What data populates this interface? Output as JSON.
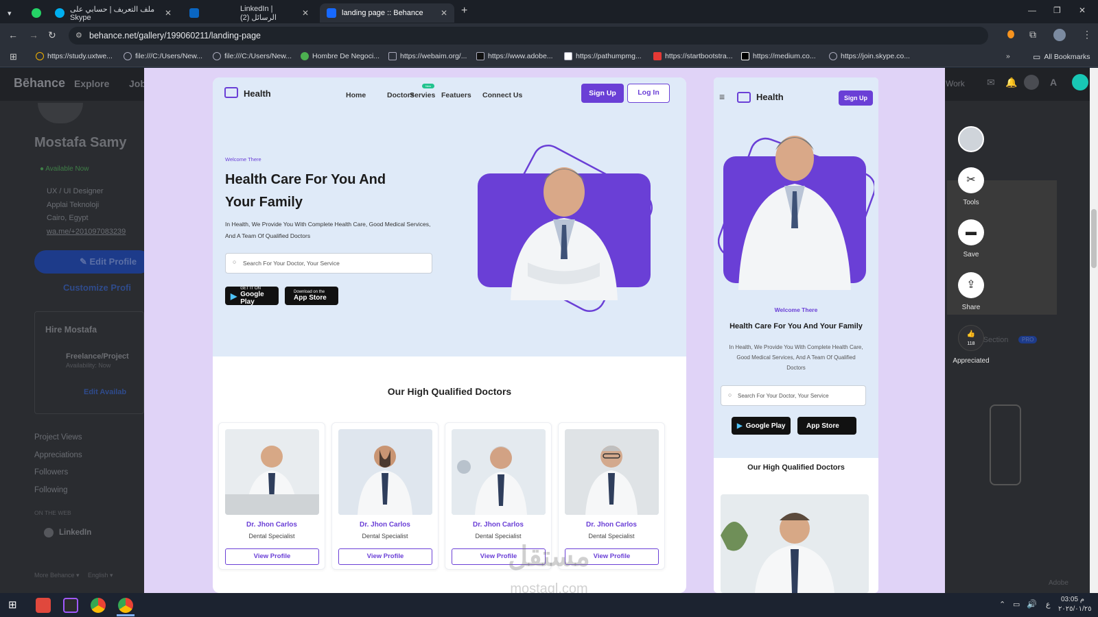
{
  "browser": {
    "tabs": [
      {
        "label": "",
        "favicon": "whatsapp-icon"
      },
      {
        "label": "ملف التعريف | حسابي على Skype",
        "favicon": "skype-icon"
      },
      {
        "label": "",
        "favicon": "linkedin-icon"
      },
      {
        "label": "LinkedIn | (الرسائل (2",
        "favicon": "linkedin-icon"
      },
      {
        "label": "landing page :: Behance",
        "favicon": "behance-icon"
      }
    ],
    "url": "behance.net/gallery/199060211/landing-page",
    "bookmarks": [
      "https://study.uxtwe...",
      "file:///C:/Users/New...",
      "file:///C:/Users/New...",
      "Hombre De Negoci...",
      "https://webaim.org/...",
      "https://www.adobe...",
      "https://pathumpmg...",
      "https://startbootstra...",
      "https://medium.co...",
      "https://join.skype.co..."
    ],
    "all_bookmarks": "All Bookmarks"
  },
  "behance": {
    "logo": "Bēhance",
    "explore": "Explore",
    "jobs": "Job",
    "profile_name": "Mostafa Samy",
    "available": "Available Now",
    "details": [
      "UX / UI Designer",
      "Applai Teknoloji",
      "Cairo, Egypt",
      "wa.me/+201097083239"
    ],
    "edit_profile": "Edit Profile",
    "customize": "Customize Profi",
    "hire": "Hire Mostafa",
    "freelance": "Freelance/Project",
    "availability": "Availability: Now",
    "edit_availability": "Edit Availab",
    "stats": [
      "Project Views",
      "Appreciations",
      "Followers",
      "Following"
    ],
    "on_the_web": "ON THE WEB",
    "linkedin": "LinkedIn",
    "more_behance": "More Behance",
    "english": "English",
    "work": "Work",
    "add_section": "Add Section",
    "pro": "PRO",
    "adobe": "Adobe"
  },
  "rail": {
    "tools": "Tools",
    "save": "Save",
    "share": "Share",
    "appreciate_count": "118",
    "appreciated": "Appreciated"
  },
  "desktop": {
    "logo": "Health",
    "nav": [
      "Home",
      "Doctors",
      "Servies",
      "Featuers",
      "Connect Us"
    ],
    "new_badge": "New",
    "signup": "Sign Up",
    "login": "Log In",
    "welcome": "Welcome There",
    "headline1": "Health Care For You And",
    "headline2": "Your Family",
    "para": "In Health, We Provide You With Complete Health Care, Good Medical Services, And A Team Of Qualified Doctors",
    "search_placeholder": "Search For Your Doctor, Your Service",
    "google_small": "GET IT ON",
    "google": "Google Play",
    "apple_small": "Download on the",
    "apple": "App Store",
    "section_title": "Our High Qualified Doctors",
    "doctors": [
      {
        "name": "Dr. Jhon Carlos",
        "spec": "Dental Specialist",
        "button": "View Profile"
      },
      {
        "name": "Dr. Jhon Carlos",
        "spec": "Dental Specialist",
        "button": "View Profile"
      },
      {
        "name": "Dr. Jhon Carlos",
        "spec": "Dental Specialist",
        "button": "View Profile"
      },
      {
        "name": "Dr. Jhon Carlos",
        "spec": "Dental Specialist",
        "button": "View Profile"
      }
    ]
  },
  "mobile": {
    "logo": "Health",
    "signup": "Sign Up",
    "welcome": "Welcome There",
    "headline": "Health Care For You And Your Family",
    "para": "In Health, We Provide You With Complete Health Care, Good Medical Services, And A Team Of Qualified Doctors",
    "search_placeholder": "Search For Your Doctor, Your Service",
    "google": "Google Play",
    "apple": "App Store",
    "section_title": "Our High Qualified Doctors"
  },
  "watermark": {
    "arabic": "مستقل",
    "latin": "mostaql.com"
  },
  "taskbar": {
    "time": "03:05 م",
    "date": "٢٠٢٥/٠١/٢٥",
    "lang": "ع"
  },
  "colors": {
    "brand": "#6a3fd6",
    "hero": "#dfeaf8"
  }
}
